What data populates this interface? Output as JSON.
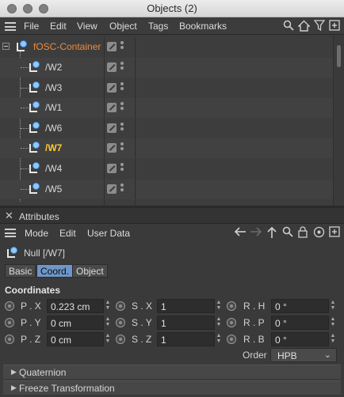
{
  "window": {
    "title": "Objects (2)"
  },
  "menubar": {
    "items": [
      "File",
      "Edit",
      "View",
      "Object",
      "Tags",
      "Bookmarks"
    ],
    "icons": [
      "search-icon",
      "home-icon",
      "filter-icon",
      "new-window-icon"
    ]
  },
  "tree": {
    "root": {
      "name": "fOSC-Container"
    },
    "children": [
      {
        "name": "/W2",
        "selected": false
      },
      {
        "name": "/W3",
        "selected": false
      },
      {
        "name": "/W1",
        "selected": false
      },
      {
        "name": "/W6",
        "selected": false
      },
      {
        "name": "/W7",
        "selected": true
      },
      {
        "name": "/W4",
        "selected": false
      },
      {
        "name": "/W5",
        "selected": false
      }
    ]
  },
  "attributes": {
    "panel_title": "Attributes",
    "menu": [
      "Mode",
      "Edit",
      "User Data"
    ],
    "object_label": "Null [/W7]",
    "tabs": [
      "Basic",
      "Coord.",
      "Object"
    ],
    "active_tab": "Coord.",
    "section": "Coordinates",
    "fields": {
      "px": {
        "label": "P . X",
        "value": "0.223 cm"
      },
      "py": {
        "label": "P . Y",
        "value": "0 cm"
      },
      "pz": {
        "label": "P . Z",
        "value": "0 cm"
      },
      "sx": {
        "label": "S . X",
        "value": "1"
      },
      "sy": {
        "label": "S . Y",
        "value": "1"
      },
      "sz": {
        "label": "S . Z",
        "value": "1"
      },
      "rh": {
        "label": "R . H",
        "value": "0 °"
      },
      "rp": {
        "label": "R . P",
        "value": "0 °"
      },
      "rb": {
        "label": "R . B",
        "value": "0 °"
      }
    },
    "order": {
      "label": "Order",
      "value": "HPB"
    },
    "collapsed_groups": [
      "Quaternion",
      "Freeze Transformation"
    ]
  },
  "colors": {
    "root_name": "#f08a3c",
    "selected_name": "#ffcc33",
    "active_tab": "#6e96c8"
  }
}
